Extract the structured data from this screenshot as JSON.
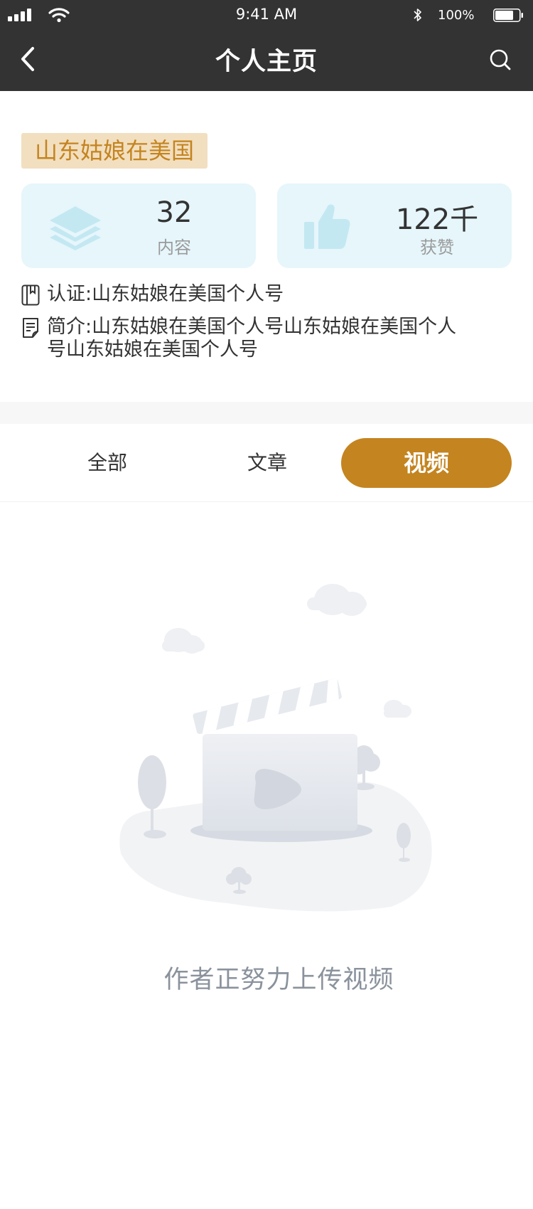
{
  "status_bar": {
    "time": "9:41 AM",
    "battery": "100%"
  },
  "nav": {
    "title": "个人主页"
  },
  "profile": {
    "name": "山东姑娘在美国",
    "stats": [
      {
        "value": "32",
        "label": "内容"
      },
      {
        "value": "122千",
        "label": "获赞"
      }
    ],
    "certification": "认证:山东姑娘在美国个人号",
    "intro_line1": "简介:山东姑娘在美国个人号山东姑娘在美国个人",
    "intro_line2": "号山东姑娘在美国个人号"
  },
  "tabs": [
    {
      "label": "全部",
      "active": false
    },
    {
      "label": "文章",
      "active": false
    },
    {
      "label": "视频",
      "active": true
    }
  ],
  "empty_state": {
    "message": "作者正努力上传视频"
  },
  "colors": {
    "accent": "#c4841f",
    "name_tag_bg": "#f2dfc0",
    "stat_card_bg": "#e6f6fb",
    "topbar_bg": "#333333"
  },
  "icons": [
    "signal-icon",
    "wifi-icon",
    "bluetooth-icon",
    "battery-icon",
    "back-arrow-icon",
    "search-icon",
    "layers-icon",
    "thumbs-up-icon",
    "bookmark-icon",
    "note-icon",
    "clapperboard-illustration"
  ]
}
